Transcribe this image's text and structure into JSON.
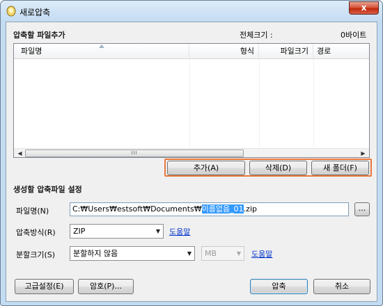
{
  "window": {
    "title": "새로압축",
    "close_label": "x"
  },
  "files": {
    "section_title": "압축할 파일추가",
    "total_size_label": "전체크기 :",
    "total_size_value": "0바이트",
    "columns": [
      "파일명",
      "형식",
      "파일크기",
      "경로"
    ],
    "scroll_grip": "III"
  },
  "actions": {
    "add": "추가(A)",
    "delete": "삭제(D)",
    "new_folder": "새 폴더(F)"
  },
  "settings": {
    "section_title": "생성할 압축파일 설정",
    "filename_label": "파일명(N)",
    "filename_prefix": "C:₩Users₩estsoft₩Documents₩",
    "filename_selected": "이름없음_01",
    "filename_suffix": ".zip",
    "browse_label": "...",
    "method_label": "압축방식(R)",
    "method_value": "ZIP",
    "method_help": "도움말",
    "split_label": "분할크기(S)",
    "split_value": "분할하지 않음",
    "unit_value": "MB",
    "split_help": "도움말"
  },
  "footer": {
    "advanced": "고급설정(E)",
    "password": "암호(P)...",
    "compress": "압축",
    "cancel": "취소"
  }
}
